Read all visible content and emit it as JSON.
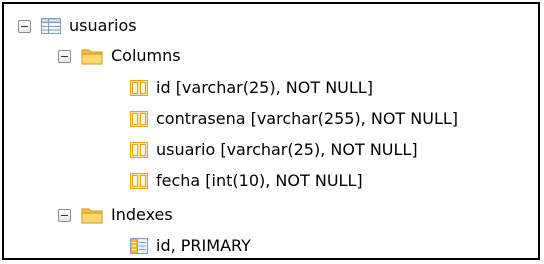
{
  "tree": {
    "table": {
      "label": "usuarios",
      "icon": "table-icon"
    },
    "columns_folder": {
      "label": "Columns",
      "icon": "folder-icon"
    },
    "columns": [
      {
        "label": "id [varchar(25), NOT NULL]",
        "icon": "column-icon"
      },
      {
        "label": "contrasena [varchar(255), NOT NULL]",
        "icon": "column-icon"
      },
      {
        "label": "usuario [varchar(25), NOT NULL]",
        "icon": "column-icon"
      },
      {
        "label": "fecha [int(10), NOT NULL]",
        "icon": "column-icon"
      }
    ],
    "indexes_folder": {
      "label": "Indexes",
      "icon": "folder-icon"
    },
    "indexes": [
      {
        "label": "id, PRIMARY",
        "icon": "index-icon"
      }
    ]
  },
  "colors": {
    "folder": "#f6c343",
    "column": "#e7a418",
    "table_grid": "#7f9db9"
  }
}
